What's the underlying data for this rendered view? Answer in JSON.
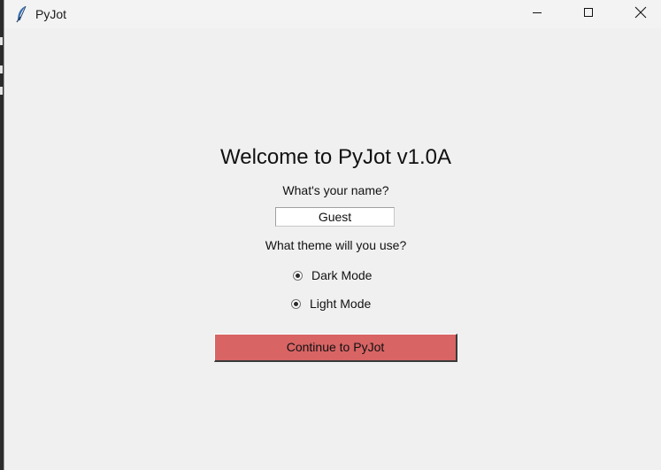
{
  "window": {
    "title": "PyJot",
    "controls": {
      "minimize": "minimize",
      "maximize": "maximize",
      "close": "close"
    }
  },
  "main": {
    "heading": "Welcome to PyJot v1.0A",
    "name_label": "What's your name?",
    "name_value": "Guest",
    "theme_label": "What theme will you use?",
    "theme_options": [
      {
        "label": "Dark Mode",
        "selected": true
      },
      {
        "label": "Light Mode",
        "selected": true
      }
    ],
    "continue_label": "Continue to PyJot"
  },
  "colors": {
    "continue_button_bg": "#d86464",
    "window_bg": "#f0f0f0",
    "titlebar_bg": "#f3f3f3",
    "icon_blue": "#3a6fb0"
  },
  "icons": {
    "app": "feather-icon",
    "minimize": "minimize-icon",
    "maximize": "maximize-icon",
    "close": "close-icon"
  }
}
